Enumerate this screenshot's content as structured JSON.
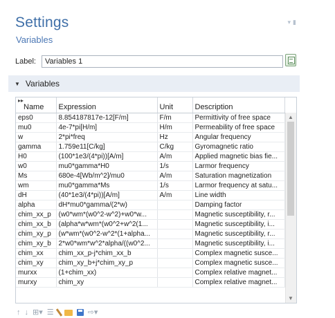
{
  "panel": {
    "title": "Settings",
    "subtitle": "Variables"
  },
  "label_field": {
    "label": "Label:",
    "value": "Variables 1"
  },
  "section": {
    "title": "Variables"
  },
  "table": {
    "columns": [
      "Name",
      "Expression",
      "Unit",
      "Description"
    ],
    "rows": [
      [
        "eps0",
        "8.854187817e-12[F/m]",
        "F/m",
        "Permittivity of free space"
      ],
      [
        "mu0",
        "4e-7*pi[H/m]",
        "H/m",
        "Permeability of free space"
      ],
      [
        "w",
        "2*pi*freq",
        "Hz",
        "Angular frequency"
      ],
      [
        "gamma",
        "1.759e11[C/kg]",
        "C/kg",
        "Gyromagnetic ratio"
      ],
      [
        "H0",
        "(100*1e3/(4*pi))[A/m]",
        "A/m",
        "Applied magnetic bias fie..."
      ],
      [
        "w0",
        "mu0*gamma*H0",
        "1/s",
        "Larmor frequency"
      ],
      [
        "Ms",
        "680e-4[Wb/m^2]/mu0",
        "A/m",
        "Saturation magnetization"
      ],
      [
        "wm",
        "mu0*gamma*Ms",
        "1/s",
        "Larmor frequency at satu..."
      ],
      [
        "dH",
        "(40*1e3/(4*pi))[A/m]",
        "A/m",
        "Line width"
      ],
      [
        "alpha",
        "dH*mu0*gamma/(2*w)",
        "",
        "Damping factor"
      ],
      [
        "chim_xx_p",
        "(w0*wm*(w0^2-w^2)+w0*w...",
        "",
        "Magnetic susceptibility, r..."
      ],
      [
        "chim_xx_b",
        "(alpha*w*wm*(w0^2+w^2(1...",
        "",
        "Magnetic susceptibility, i..."
      ],
      [
        "chim_xy_p",
        "(w*wm*(w0^2-w^2*(1+alpha...",
        "",
        "Magnetic susceptibility, r..."
      ],
      [
        "chim_xy_b",
        "2*w0*wm*w^2*alpha/((w0^2...",
        "",
        "Magnetic susceptibility, i..."
      ],
      [
        "chim_xx",
        "chim_xx_p-j*chim_xx_b",
        "",
        "Complex magnetic susce..."
      ],
      [
        "chim_xy",
        "chim_xy_b+j*chim_xy_p",
        "",
        "Complex magnetic susce..."
      ],
      [
        "murxx",
        "(1+chim_xx)",
        "",
        "Complex relative magnet..."
      ],
      [
        "murxy",
        "chim_xy",
        "",
        "Complex relative magnet..."
      ]
    ]
  },
  "toolbar": {
    "icons": [
      "arrow-up-icon",
      "arrow-down-icon",
      "delete-row-icon",
      "clear-table-icon",
      "brush-icon",
      "open-folder-icon",
      "save-icon",
      "import-icon"
    ]
  }
}
